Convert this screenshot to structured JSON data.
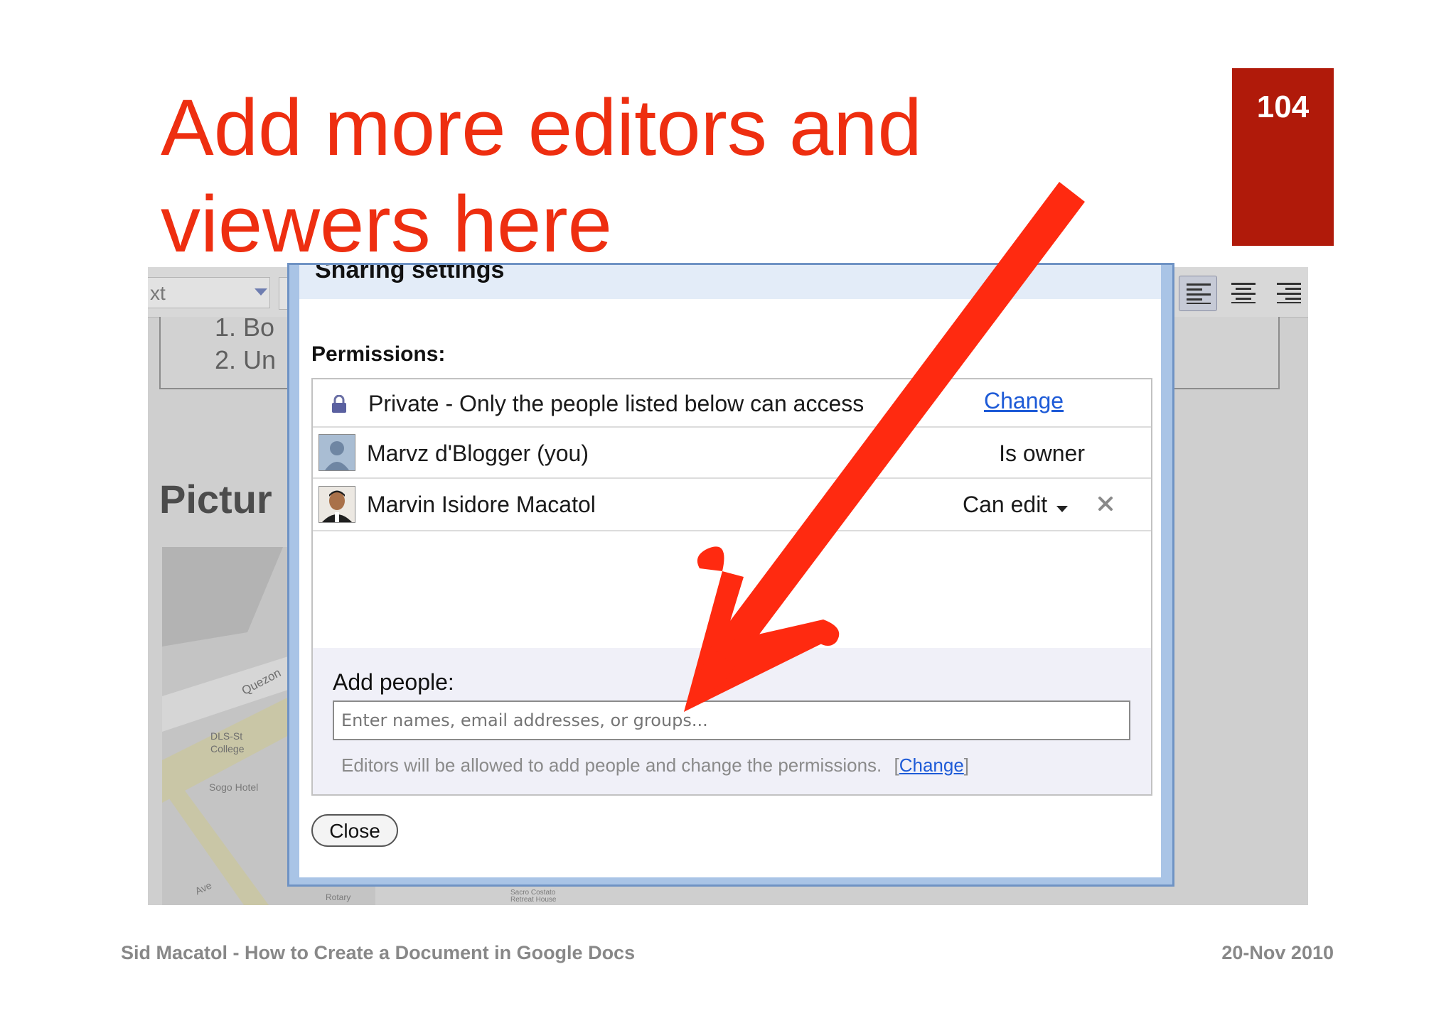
{
  "slide": {
    "title": "Add more editors and viewers here",
    "page_number": "104",
    "title_color": "#ee2e10",
    "accent_color": "#b01a0a"
  },
  "screenshot": {
    "toolbar": {
      "font_select": "xt"
    },
    "document": {
      "list_item_1": "1.  Bo",
      "list_item_2": "2.  Un",
      "heading": "Pictur"
    },
    "map": {
      "street_1": "Quezon",
      "place_1": "DLS-St",
      "place_2": "College",
      "place_3": "Sogo Hotel",
      "street_2": "Ave",
      "place_4": "Rotary",
      "place_5": "Sacro Costato Retreat House"
    },
    "dialog": {
      "title": "Sharing settings",
      "permissions_label": "Permissions:",
      "rows": [
        {
          "text": "Private - Only the people listed below can access",
          "action": "Change",
          "icon": "lock-icon"
        },
        {
          "text": "Marvz d'Blogger (you)",
          "role": "Is owner",
          "icon": "avatar-placeholder"
        },
        {
          "text": "Marvin Isidore Macatol",
          "role": "Can edit",
          "icon": "avatar-photo"
        }
      ],
      "add_people_label": "Add people:",
      "add_people_placeholder": "Enter names, email addresses, or groups...",
      "editors_note": "Editors will be allowed to add people and change the permissions.",
      "editors_note_link": "Change",
      "close_label": "Close"
    }
  },
  "footer": {
    "left": "Sid Macatol - How to Create a Document in Google Docs",
    "right": "20-Nov 2010"
  }
}
